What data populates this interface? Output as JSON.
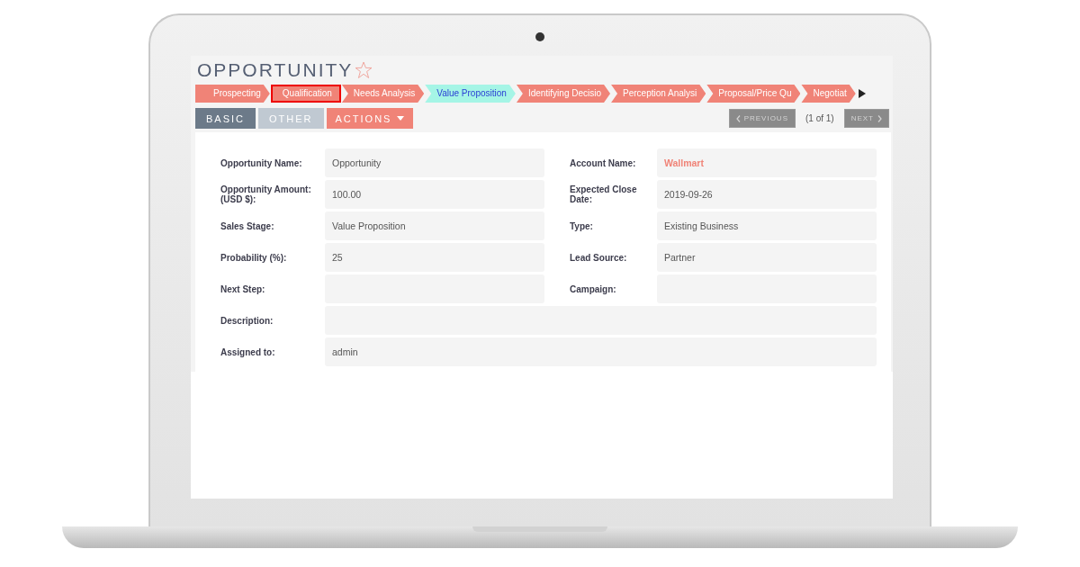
{
  "page": {
    "title": "OPPORTUNITY",
    "favorite": false
  },
  "stages": [
    {
      "label": "Prospecting",
      "selected": false,
      "outlined": false
    },
    {
      "label": "Qualification",
      "selected": false,
      "outlined": true
    },
    {
      "label": "Needs Analysis",
      "selected": false,
      "outlined": false
    },
    {
      "label": "Value Proposition",
      "selected": true,
      "outlined": false
    },
    {
      "label": "Identifying Decisio",
      "selected": false,
      "outlined": false
    },
    {
      "label": "Perception Analysi",
      "selected": false,
      "outlined": false
    },
    {
      "label": "Proposal/Price Qu",
      "selected": false,
      "outlined": false
    },
    {
      "label": "Negotiat",
      "selected": false,
      "outlined": false
    }
  ],
  "tabs": [
    {
      "label": "BASIC",
      "selected": true
    },
    {
      "label": "OTHER",
      "selected": false
    }
  ],
  "actions": {
    "label": "ACTIONS"
  },
  "pager": {
    "previous": {
      "label": "PREVIOUS",
      "disabled": true
    },
    "position": "(1 of 1)",
    "next": {
      "label": "NEXT",
      "disabled": true
    }
  },
  "rows": [
    {
      "fields": [
        {
          "label": "Opportunity Name:",
          "value": "Opportunity",
          "kind": "text"
        },
        {
          "label": "Account Name:",
          "value": "Wallmart",
          "kind": "link"
        }
      ]
    },
    {
      "fields": [
        {
          "label": "Opportunity Amount: (USD $):",
          "value": "100.00",
          "kind": "text"
        },
        {
          "label": "Expected Close Date:",
          "value": "2019-09-26",
          "kind": "text"
        }
      ]
    },
    {
      "fields": [
        {
          "label": "Sales Stage:",
          "value": "Value Proposition",
          "kind": "text"
        },
        {
          "label": "Type:",
          "value": "Existing Business",
          "kind": "text"
        }
      ]
    },
    {
      "fields": [
        {
          "label": "Probability (%):",
          "value": "25",
          "kind": "text"
        },
        {
          "label": "Lead Source:",
          "value": "Partner",
          "kind": "text"
        }
      ]
    },
    {
      "fields": [
        {
          "label": "Next Step:",
          "kind": "text"
        },
        {
          "label": "Campaign:",
          "kind": "text"
        }
      ]
    },
    {
      "fields": [
        {
          "label": "Description:",
          "kind": "text"
        }
      ]
    },
    {
      "fields": [
        {
          "label": "Assigned to:",
          "value": "admin",
          "kind": "text"
        }
      ]
    }
  ]
}
